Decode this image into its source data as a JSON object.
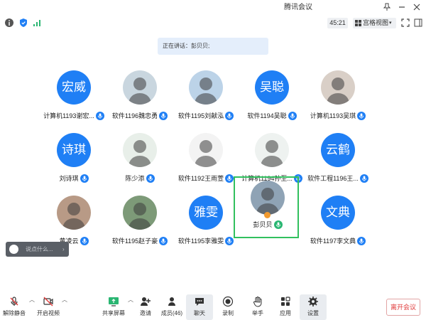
{
  "app": {
    "title": "腾讯会议"
  },
  "toolbar": {
    "timer": "45:21",
    "view_label": "宫格视图"
  },
  "speaker": {
    "text": "正在讲话：彭贝贝;"
  },
  "participants": [
    {
      "name": "计算机1193谢宏...",
      "avatar_text": "宏威",
      "avatar_type": "text"
    },
    {
      "name": "软件1196魏忠勇",
      "avatar_text": "",
      "avatar_type": "photo"
    },
    {
      "name": "软件1195刘献泓",
      "avatar_text": "",
      "avatar_type": "photo"
    },
    {
      "name": "软件1194吴聪",
      "avatar_text": "吴聪",
      "avatar_type": "text"
    },
    {
      "name": "计算机1193吴琪",
      "avatar_text": "",
      "avatar_type": "photo"
    },
    {
      "name": "刘诗琪",
      "avatar_text": "诗琪",
      "avatar_type": "text"
    },
    {
      "name": "陈少添",
      "avatar_text": "",
      "avatar_type": "photo"
    },
    {
      "name": "软件1192王雨萱",
      "avatar_text": "",
      "avatar_type": "photo"
    },
    {
      "name": "计算机1194孙至...",
      "avatar_text": "",
      "avatar_type": "photo"
    },
    {
      "name": "软件工程1196王...",
      "avatar_text": "云鹤",
      "avatar_type": "text"
    },
    {
      "name": "黄凌云",
      "avatar_text": "",
      "avatar_type": "photo"
    },
    {
      "name": "软件1195赵子豪",
      "avatar_text": "",
      "avatar_type": "photo"
    },
    {
      "name": "软件1195李雅雯",
      "avatar_text": "雅雯",
      "avatar_type": "text"
    },
    {
      "name": "彭贝贝",
      "avatar_text": "",
      "avatar_type": "photo"
    },
    {
      "name": "软件1197李文典",
      "avatar_text": "文典",
      "avatar_type": "text"
    }
  ],
  "chat": {
    "placeholder": "说点什么..."
  },
  "bottombar": {
    "unmute": "解除静音",
    "video": "开启视频",
    "share": "共享屏幕",
    "invite": "邀请",
    "members": "成员(46)",
    "chat": "聊天",
    "record": "录制",
    "raise_hand": "举手",
    "apps": "应用",
    "settings": "设置",
    "leave": "离开会议"
  },
  "colors": {
    "accent": "#1f7ff5",
    "speaking": "#31c05e",
    "leave": "#e03a3a"
  }
}
